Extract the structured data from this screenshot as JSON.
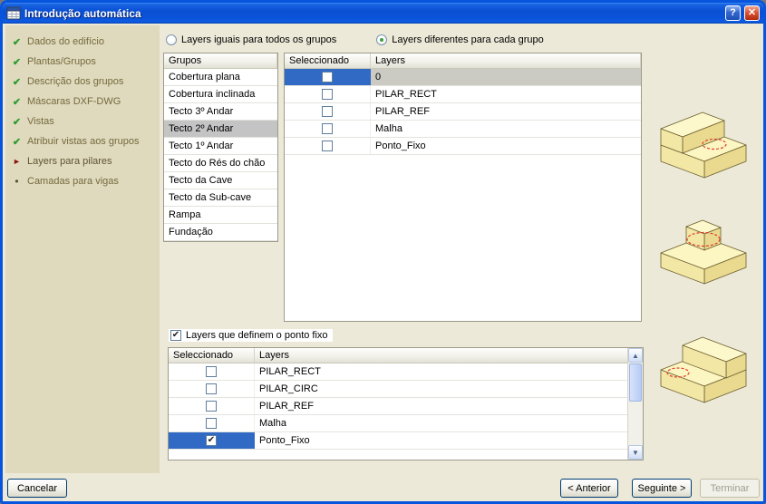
{
  "window": {
    "title": "Introdução automática"
  },
  "titlebar_icons": {
    "help": "?",
    "close": "✕"
  },
  "sidebar": {
    "items": [
      {
        "label": "Dados do edifício",
        "state": "done"
      },
      {
        "label": "Plantas/Grupos",
        "state": "done"
      },
      {
        "label": "Descrição dos grupos",
        "state": "done"
      },
      {
        "label": "Máscaras DXF-DWG",
        "state": "done"
      },
      {
        "label": "Vistas",
        "state": "done"
      },
      {
        "label": "Atribuir vistas aos grupos",
        "state": "done"
      },
      {
        "label": "Layers para pilares",
        "state": "current"
      },
      {
        "label": "Camadas para vigas",
        "state": "pending"
      }
    ]
  },
  "options": {
    "radio_equal": "Layers iguais para todos os grupos",
    "radio_different": "Layers diferentes para cada grupo",
    "selected": "different"
  },
  "groups": {
    "header": "Grupos",
    "selected_index": 3,
    "items": [
      "Cobertura plana",
      "Cobertura inclinada",
      "Tecto 3º Andar",
      "Tecto 2º Andar",
      "Tecto 1º Andar",
      "Tecto do Rés do chão",
      "Tecto da Cave",
      "Tecto da Sub-cave",
      "Rampa",
      "Fundação"
    ]
  },
  "layers_table": {
    "columns": [
      "Seleccionado",
      "Layers"
    ],
    "rows": [
      {
        "layer": "0",
        "checked": false,
        "selected": true
      },
      {
        "layer": "PILAR_RECT",
        "checked": false,
        "selected": false
      },
      {
        "layer": "PILAR_REF",
        "checked": false,
        "selected": false
      },
      {
        "layer": "Malha",
        "checked": false,
        "selected": false
      },
      {
        "layer": "Ponto_Fixo",
        "checked": false,
        "selected": false
      }
    ]
  },
  "fixed_point": {
    "label": "Layers que definem o ponto fixo",
    "checked": true,
    "columns": [
      "Seleccionado",
      "Layers"
    ],
    "rows": [
      {
        "layer": "PILAR_RECT",
        "checked": false,
        "selected": false
      },
      {
        "layer": "PILAR_CIRC",
        "checked": false,
        "selected": false
      },
      {
        "layer": "PILAR_REF",
        "checked": false,
        "selected": false
      },
      {
        "layer": "Malha",
        "checked": false,
        "selected": false
      },
      {
        "layer": "Ponto_Fixo",
        "checked": true,
        "selected": true
      }
    ]
  },
  "scrollbar": {
    "up": "▲",
    "down": "▼"
  },
  "footer": {
    "cancel": "Cancelar",
    "previous": "< Anterior",
    "next": "Seguinte >",
    "finish": "Terminar"
  },
  "colors": {
    "selection_blue": "#316AC5",
    "titlebar_blue": "#0A50D4",
    "sidebar_beige": "#DFD9BE",
    "check_green": "#2E9D2E",
    "arrow_red": "#8B150D"
  }
}
